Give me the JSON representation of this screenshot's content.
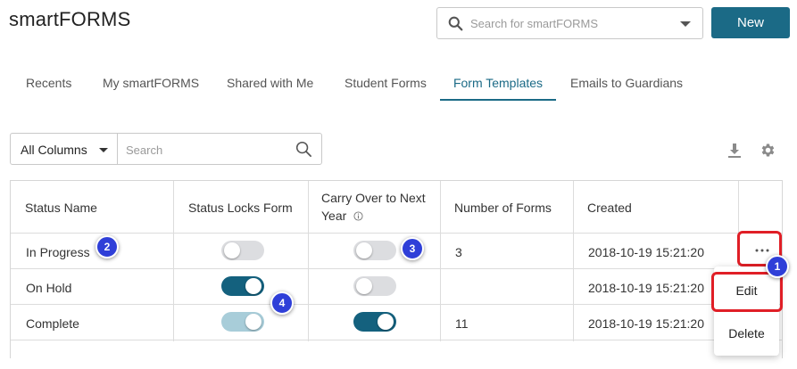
{
  "app": {
    "title": "smartFORMS"
  },
  "header": {
    "search_placeholder": "Search for smartFORMS",
    "new_button": "New"
  },
  "tabs": [
    {
      "label": "Recents",
      "active": false
    },
    {
      "label": "My smartFORMS",
      "active": false
    },
    {
      "label": "Shared with Me",
      "active": false
    },
    {
      "label": "Student Forms",
      "active": false
    },
    {
      "label": "Form Templates",
      "active": true
    },
    {
      "label": "Emails to Guardians",
      "active": false
    }
  ],
  "toolbar": {
    "column_filter": "All Columns",
    "search_placeholder": "Search",
    "download_icon": "download-icon",
    "settings_icon": "gear-icon"
  },
  "table": {
    "headers": {
      "status_name": "Status Name",
      "status_locks": "Status Locks Form",
      "carry_over_line1": "Carry Over to Next",
      "carry_over_line2": "Year",
      "num_forms": "Number of Forms",
      "created": "Created"
    },
    "rows": [
      {
        "status_name": "In Progress",
        "status_locks": "off",
        "carry_over": "off",
        "num_forms": "3",
        "created": "2018-10-19 15:21:20"
      },
      {
        "status_name": "On Hold",
        "status_locks": "on",
        "carry_over": "off",
        "num_forms": "",
        "created": "2018-10-19 15:21:20"
      },
      {
        "status_name": "Complete",
        "status_locks": "on-dim",
        "carry_over": "on",
        "num_forms": "11",
        "created": "2018-10-19 15:21:20"
      }
    ]
  },
  "menu": {
    "edit": "Edit",
    "delete": "Delete"
  },
  "markers": {
    "m1": "1",
    "m2": "2",
    "m3": "3",
    "m4": "4"
  },
  "colors": {
    "accent": "#1b6a86",
    "highlight": "#e01e26",
    "marker": "#2f3fd8"
  }
}
